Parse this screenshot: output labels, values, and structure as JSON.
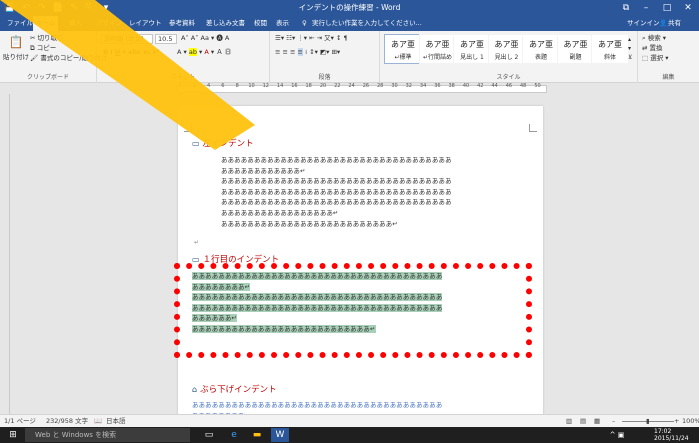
{
  "titlebar": {
    "title": "インデントの操作練習 - Word",
    "quick_access": [
      "💾",
      "↶",
      "↷",
      "📄",
      "✎",
      "🔍",
      "▾"
    ],
    "controls": [
      "⧉",
      "–",
      "□",
      "✕"
    ]
  },
  "tabs": [
    "ファイル",
    "ホーム",
    "挿入",
    "デザイン",
    "レイアウト",
    "参考資料",
    "差し込み文書",
    "校閲",
    "表示"
  ],
  "tell_me": "実行したい作業を入力してください...",
  "account": {
    "signin": "サインイン",
    "share": "共有"
  },
  "ribbon": {
    "clipboard": {
      "paste": "貼り付け",
      "cut": "切り取り",
      "copy": "コピー",
      "format_painter": "書式のコピー/貼り付け",
      "label": "クリップボード"
    },
    "font": {
      "name": "游明朝 (本文)",
      "size": "10.5",
      "label": "フォント"
    },
    "paragraph": {
      "label": "段落"
    },
    "styles": {
      "label": "スタイル",
      "items": [
        {
          "preview": "あア亜",
          "name": "↵標準"
        },
        {
          "preview": "あア亜",
          "name": "↵行間詰め"
        },
        {
          "preview": "あア亜",
          "name": "見出し 1"
        },
        {
          "preview": "あア亜",
          "name": "見出し 2"
        },
        {
          "preview": "あア亜",
          "name": "表題"
        },
        {
          "preview": "あア亜",
          "name": "副題"
        },
        {
          "preview": "あア亜",
          "name": "斜体"
        }
      ]
    },
    "editing": {
      "find": "検索",
      "replace": "置換",
      "select": "選択",
      "label": "編集"
    }
  },
  "ruler_numbers": [
    "2",
    "2",
    "4",
    "6",
    "8",
    "10",
    "12",
    "14",
    "16",
    "18",
    "20",
    "22",
    "24",
    "26",
    "28",
    "30",
    "32",
    "34",
    "36",
    "38",
    "40",
    "42",
    "44",
    "46",
    "48",
    "50"
  ],
  "document": {
    "heading1": "左インデント",
    "left_indent_lines": [
      "あああああああああああああああああああああああああああああああああああ",
      "ああああああああああああ↵",
      "あああああああああああああああああああああああああああああああああああ",
      "あああああああああああああああああああああああああああああああああああ",
      "あああああああああああああああああああああああああああああああああああ",
      "あああああああああああああああああ↵",
      "ああああああああああああああああああああああああああ↵"
    ],
    "heading2": "１行目のインデント",
    "first_line_lines": [
      "ああああああああああああああああああああああああああああああああああああああ",
      "ああああああああ↵",
      "ああああああああああああああああああああああああああああああああああああああ",
      "ああああああああああああああああああああああああああああああああああああああ",
      "ああああああ↵",
      "あああああああああああああああああああああああああああ↵"
    ],
    "heading3": "ぶら下げインデント",
    "hanging_lines": [
      "ああああああああああああああああああああああああああああああああああああああ",
      "ああああああああ↵"
    ]
  },
  "statusbar": {
    "page": "1/1 ページ",
    "words": "232/958 文字",
    "lang": "日本語",
    "zoom": "100%"
  },
  "taskbar": {
    "search": "Web と Windows を検索",
    "time": "17:02",
    "date": "2015/11/24"
  },
  "colors": {
    "accent": "#2b579a",
    "heading": "#c00000",
    "highlight": "#a8cfb7",
    "frame": "#ff0000"
  }
}
